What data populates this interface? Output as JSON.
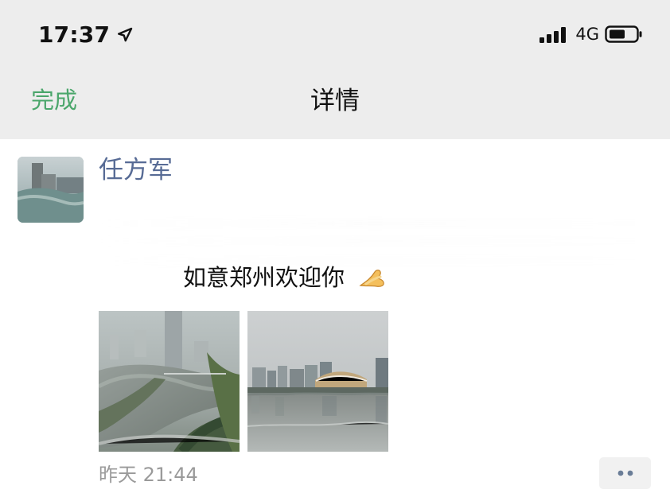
{
  "status_bar": {
    "time": "17:37",
    "network": "4G",
    "icons": {
      "location": "location-arrow-icon",
      "signal": "cellular-signal-icon",
      "battery": "battery-icon"
    }
  },
  "nav": {
    "done_label": "完成",
    "title": "详情"
  },
  "post": {
    "author": "任方军",
    "text": "如意郑州欢迎你",
    "emoji": "pinching-hand-emoji",
    "time": "昨天 21:44",
    "photos": [
      "city-river-photo",
      "lake-skyline-photo"
    ]
  },
  "colors": {
    "header_bg": "#ededed",
    "accent_green": "#4ba66b",
    "username_blue": "#576b95",
    "secondary_gray": "#9a9a9a"
  }
}
